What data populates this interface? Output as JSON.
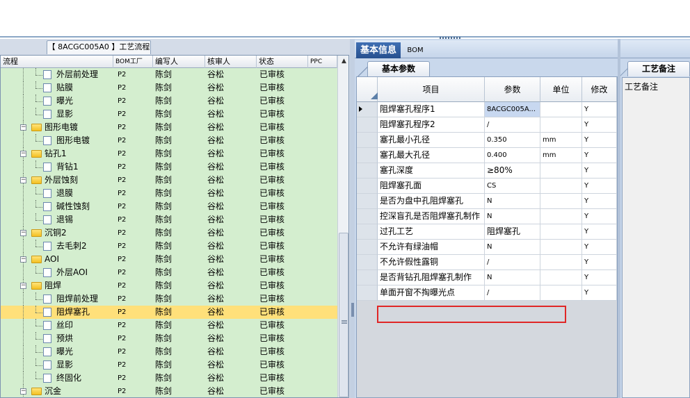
{
  "left": {
    "process_tab": "【 8ACGC005A0 】工艺流程",
    "headers": [
      "流程",
      "BOM工厂",
      "编写人",
      "核审人",
      "状态",
      "PPC"
    ],
    "rows": [
      {
        "level": 2,
        "type": "file",
        "name": "外层前处理",
        "bom": "P2",
        "author": "陈剑",
        "reviewer": "谷松",
        "status": "已审核"
      },
      {
        "level": 2,
        "type": "file",
        "name": "贴膜",
        "bom": "P2",
        "author": "陈剑",
        "reviewer": "谷松",
        "status": "已审核"
      },
      {
        "level": 2,
        "type": "file",
        "name": "曝光",
        "bom": "P2",
        "author": "陈剑",
        "reviewer": "谷松",
        "status": "已审核"
      },
      {
        "level": 2,
        "type": "file",
        "name": "显影",
        "bom": "P2",
        "author": "陈剑",
        "reviewer": "谷松",
        "status": "已审核"
      },
      {
        "level": 1,
        "type": "folder",
        "name": "图形电镀",
        "bom": "P2",
        "author": "陈剑",
        "reviewer": "谷松",
        "status": "已审核"
      },
      {
        "level": 2,
        "type": "file",
        "name": "图形电镀",
        "bom": "P2",
        "author": "陈剑",
        "reviewer": "谷松",
        "status": "已审核"
      },
      {
        "level": 1,
        "type": "folder",
        "name": "钻孔1",
        "bom": "P2",
        "author": "陈剑",
        "reviewer": "谷松",
        "status": "已审核"
      },
      {
        "level": 2,
        "type": "file",
        "name": "背钻1",
        "bom": "P2",
        "author": "陈剑",
        "reviewer": "谷松",
        "status": "已审核"
      },
      {
        "level": 1,
        "type": "folder",
        "name": "外层蚀刻",
        "bom": "P2",
        "author": "陈剑",
        "reviewer": "谷松",
        "status": "已审核"
      },
      {
        "level": 2,
        "type": "file",
        "name": "退膜",
        "bom": "P2",
        "author": "陈剑",
        "reviewer": "谷松",
        "status": "已审核"
      },
      {
        "level": 2,
        "type": "file",
        "name": "碱性蚀刻",
        "bom": "P2",
        "author": "陈剑",
        "reviewer": "谷松",
        "status": "已审核"
      },
      {
        "level": 2,
        "type": "file",
        "name": "退锡",
        "bom": "P2",
        "author": "陈剑",
        "reviewer": "谷松",
        "status": "已审核"
      },
      {
        "level": 1,
        "type": "folder",
        "name": "沉铜2",
        "bom": "P2",
        "author": "陈剑",
        "reviewer": "谷松",
        "status": "已审核"
      },
      {
        "level": 2,
        "type": "file",
        "name": "去毛刺2",
        "bom": "P2",
        "author": "陈剑",
        "reviewer": "谷松",
        "status": "已审核"
      },
      {
        "level": 1,
        "type": "folder",
        "name": "AOI",
        "bom": "P2",
        "author": "陈剑",
        "reviewer": "谷松",
        "status": "已审核"
      },
      {
        "level": 2,
        "type": "file",
        "name": "外层AOI",
        "bom": "P2",
        "author": "陈剑",
        "reviewer": "谷松",
        "status": "已审核"
      },
      {
        "level": 1,
        "type": "folder",
        "name": "阻焊",
        "bom": "P2",
        "author": "陈剑",
        "reviewer": "谷松",
        "status": "已审核"
      },
      {
        "level": 2,
        "type": "file",
        "name": "阻焊前处理",
        "bom": "P2",
        "author": "陈剑",
        "reviewer": "谷松",
        "status": "已审核"
      },
      {
        "level": 2,
        "type": "file",
        "name": "阻焊塞孔",
        "bom": "P2",
        "author": "陈剑",
        "reviewer": "谷松",
        "status": "已审核",
        "selected": true
      },
      {
        "level": 2,
        "type": "file",
        "name": "丝印",
        "bom": "P2",
        "author": "陈剑",
        "reviewer": "谷松",
        "status": "已审核"
      },
      {
        "level": 2,
        "type": "file",
        "name": "预烘",
        "bom": "P2",
        "author": "陈剑",
        "reviewer": "谷松",
        "status": "已审核"
      },
      {
        "level": 2,
        "type": "file",
        "name": "曝光",
        "bom": "P2",
        "author": "陈剑",
        "reviewer": "谷松",
        "status": "已审核"
      },
      {
        "level": 2,
        "type": "file",
        "name": "显影",
        "bom": "P2",
        "author": "陈剑",
        "reviewer": "谷松",
        "status": "已审核"
      },
      {
        "level": 2,
        "type": "file",
        "name": "终固化",
        "bom": "P2",
        "author": "陈剑",
        "reviewer": "谷松",
        "status": "已审核"
      },
      {
        "level": 1,
        "type": "folder",
        "name": "沉金",
        "bom": "P2",
        "author": "陈剑",
        "reviewer": "谷松",
        "status": "已审核"
      }
    ]
  },
  "right": {
    "tabs": [
      "基本信息",
      "BOM"
    ],
    "subtab": "基本参数",
    "remark_tab": "工艺备注",
    "remark_label": "工艺备注",
    "headers": [
      "项目",
      "参数",
      "单位",
      "修改"
    ],
    "rows": [
      {
        "item": "阻焊塞孔程序1",
        "param": "8ACGC005A...",
        "unit": "",
        "mod": "Y",
        "current": true
      },
      {
        "item": "阻焊塞孔程序2",
        "param": "/",
        "unit": "",
        "mod": "Y"
      },
      {
        "item": "塞孔最小孔径",
        "param": "0.350",
        "unit": "mm",
        "mod": "Y"
      },
      {
        "item": "塞孔最大孔径",
        "param": "0.400",
        "unit": "mm",
        "mod": "Y"
      },
      {
        "item": "塞孔深度",
        "param": "≥80%",
        "unit": "",
        "mod": "Y"
      },
      {
        "item": "阻焊塞孔面",
        "param": "CS",
        "unit": "",
        "mod": "Y"
      },
      {
        "item": "是否为盘中孔阻焊塞孔",
        "param": "N",
        "unit": "",
        "mod": "Y"
      },
      {
        "item": "控深盲孔是否阻焊塞孔制作",
        "param": "N",
        "unit": "",
        "mod": "Y"
      },
      {
        "item": "过孔工艺",
        "param": "阻焊塞孔",
        "unit": "",
        "mod": "Y"
      },
      {
        "item": "不允许有绿油帽",
        "param": "N",
        "unit": "",
        "mod": "Y"
      },
      {
        "item": "不允许假性露铜",
        "param": "/",
        "unit": "",
        "mod": "Y"
      },
      {
        "item": "是否背钻孔阻焊塞孔制作",
        "param": "N",
        "unit": "",
        "mod": "Y",
        "highlighted": true
      },
      {
        "item": "单面开窗不掏曝光点",
        "param": "/",
        "unit": "",
        "mod": "Y"
      }
    ]
  },
  "icons": {
    "file": "file-icon",
    "folder": "folder-icon",
    "expander": "collapse-icon",
    "scroll_up": "arrow-up-icon",
    "row_marker": "current-row-arrow-icon"
  },
  "colors": {
    "tree_bg": "#d4eecf",
    "selected_row": "#ffe07a",
    "active_tab": "#2f5d9e",
    "highlight": "#e02626"
  }
}
